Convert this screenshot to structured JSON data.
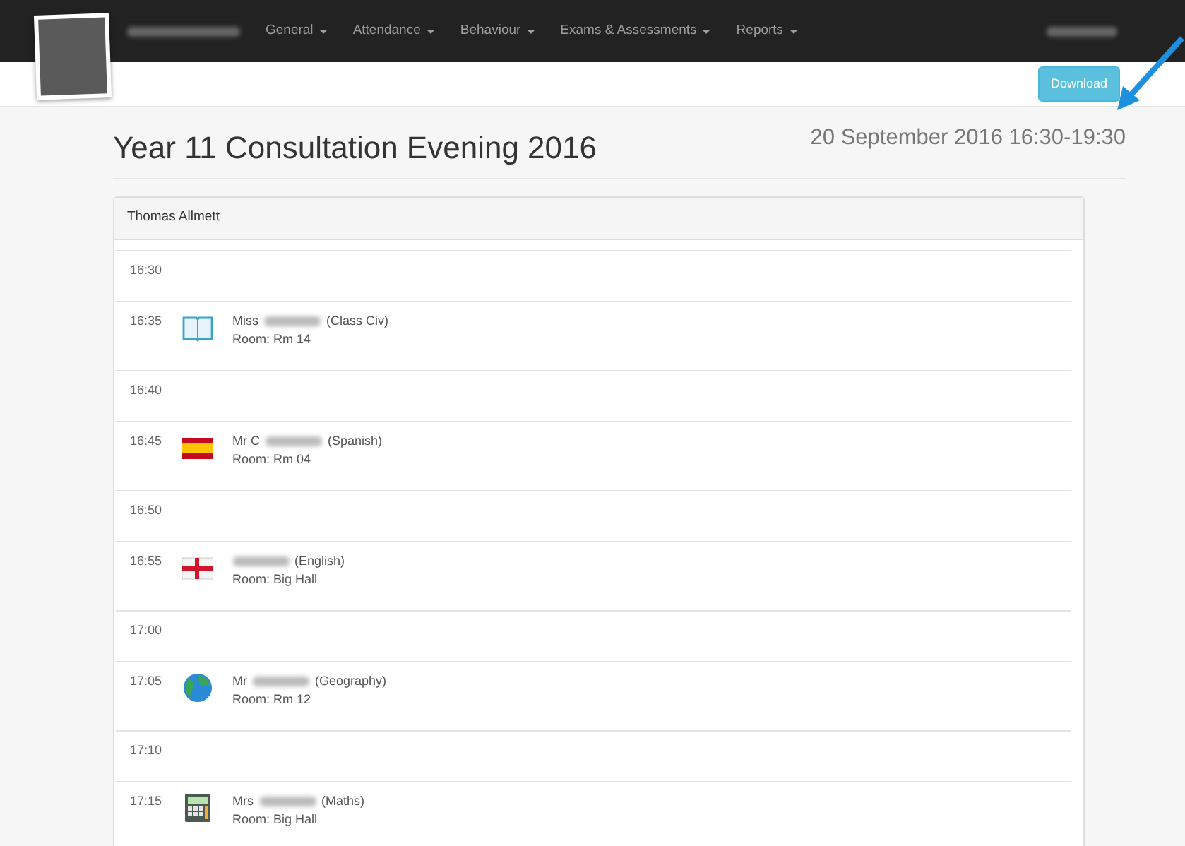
{
  "navbar": {
    "menus": [
      {
        "label": "General"
      },
      {
        "label": "Attendance"
      },
      {
        "label": "Behaviour"
      },
      {
        "label": "Exams & Assessments"
      },
      {
        "label": "Reports"
      }
    ]
  },
  "toolbar": {
    "button": "Download"
  },
  "header": {
    "title": "Year 11 Consultation Evening 2016",
    "date": "20 September 2016 16:30-19:30"
  },
  "panel": {
    "student": "Thomas Allmett",
    "slots": [
      {
        "time": "16:30"
      },
      {
        "time": "16:35",
        "appointment": {
          "kind": "book",
          "title": "Miss",
          "subject": "(Class Civ)",
          "room": "Room: Rm 14"
        }
      },
      {
        "time": "16:40"
      },
      {
        "time": "16:45",
        "appointment": {
          "kind": "spain",
          "title": "Mr C",
          "subject": "(Spanish)",
          "room": "Room: Rm 04"
        }
      },
      {
        "time": "16:50"
      },
      {
        "time": "16:55",
        "appointment": {
          "kind": "england",
          "subject": "(English)",
          "room": "Room: Big Hall"
        }
      },
      {
        "time": "17:00"
      },
      {
        "time": "17:05",
        "appointment": {
          "kind": "globe",
          "title": "Mr",
          "subject": "(Geography)",
          "room": "Room: Rm 12"
        }
      },
      {
        "time": "17:10"
      },
      {
        "time": "17:15",
        "appointment": {
          "kind": "calculator",
          "title": "Mrs",
          "subject": "(Maths)",
          "room": "Room: Big Hall"
        }
      }
    ]
  }
}
